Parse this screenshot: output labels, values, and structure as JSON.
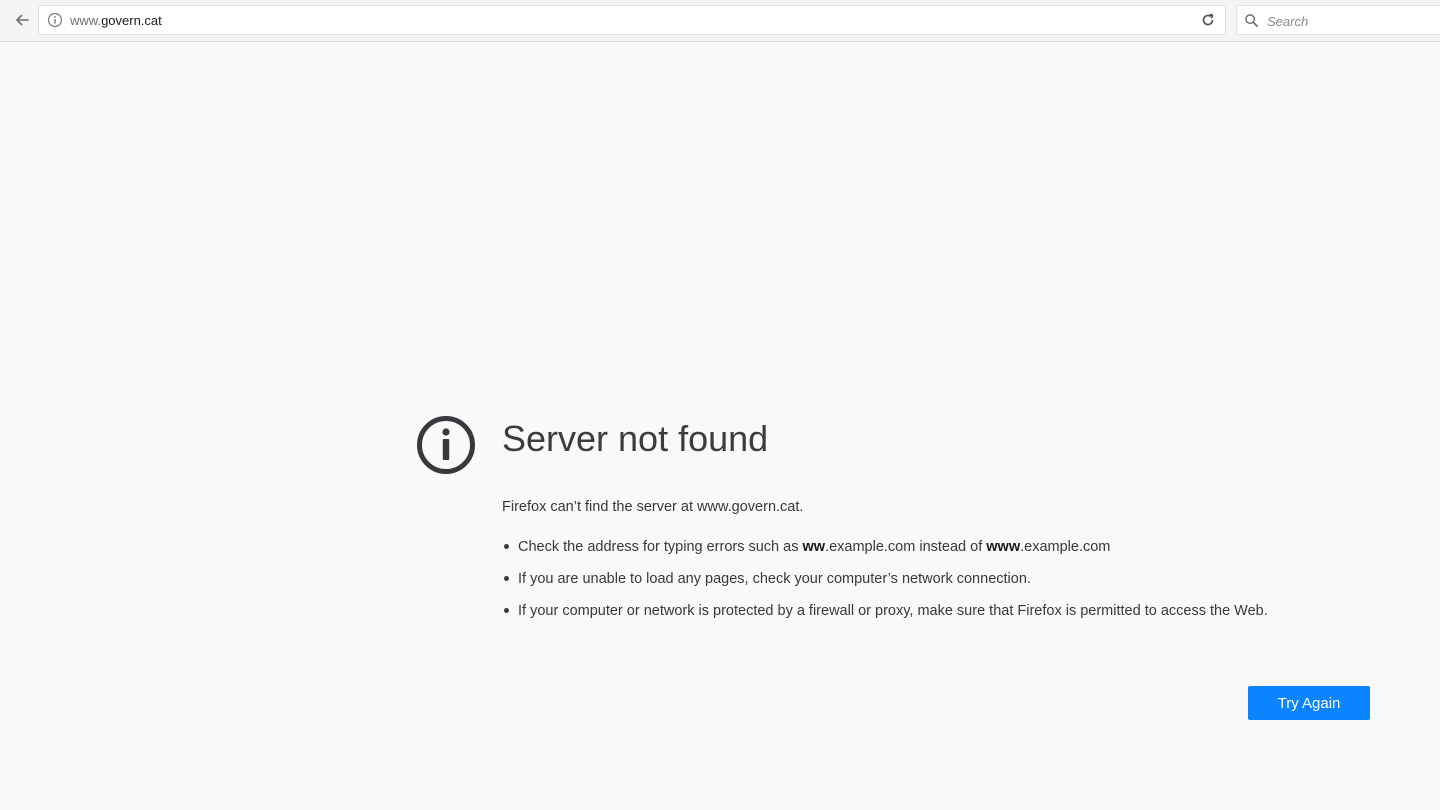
{
  "browser": {
    "url_prefix": "www.",
    "url_host": "govern.cat",
    "search_placeholder": "Search"
  },
  "error_page": {
    "title": "Server not found",
    "description": "Firefox can’t find the server at www.govern.cat.",
    "suggestions": [
      {
        "before": "Check the address for typing errors such as ",
        "bold1": "ww",
        "middle": ".example.com instead of ",
        "bold2": "www",
        "after": ".example.com"
      },
      {
        "text": "If you are unable to load any pages, check your computer’s network connection."
      },
      {
        "text": "If your computer or network is protected by a firewall or proxy, make sure that Firefox is permitted to access the Web."
      }
    ],
    "try_again_label": "Try Again"
  },
  "colors": {
    "accent": "#0a84ff",
    "page_background": "#f9f9fa",
    "text": "#38383d"
  },
  "icons": {
    "back": "back-arrow-icon",
    "site_info": "info-icon",
    "reload": "reload-icon",
    "search": "search-icon",
    "error": "info-circle-icon"
  }
}
